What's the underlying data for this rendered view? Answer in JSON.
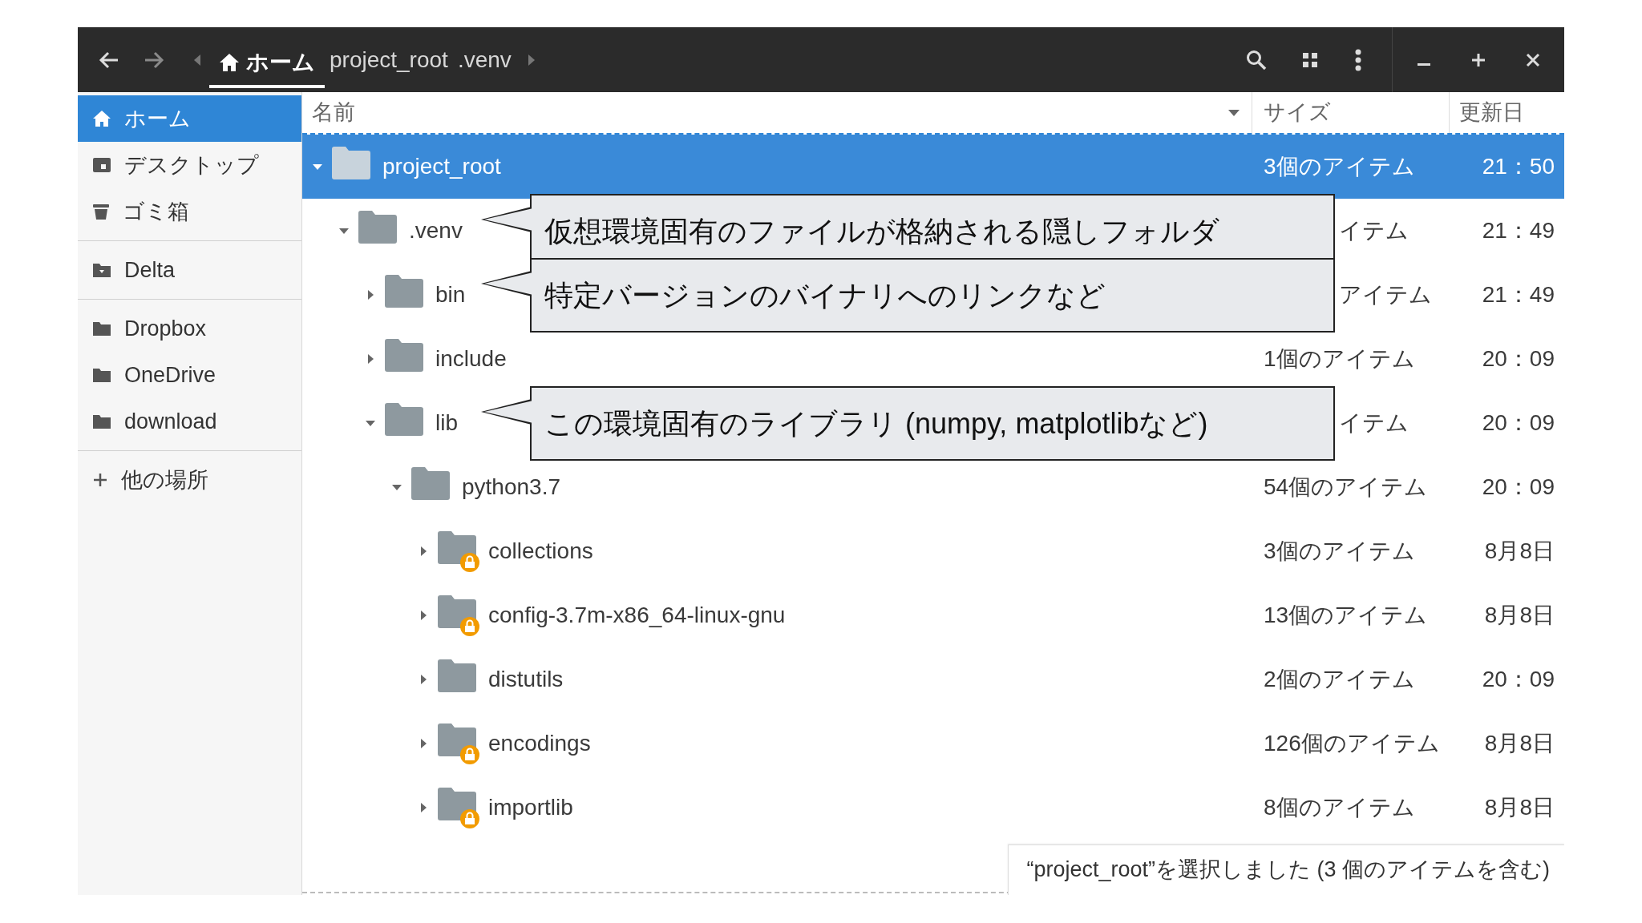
{
  "header_bar": {
    "path": [
      {
        "label": "ホーム",
        "kind": "home",
        "selected": true
      },
      {
        "label": "project_root",
        "kind": "folder",
        "selected": false
      },
      {
        "label": ".venv",
        "kind": "folder",
        "selected": false
      }
    ]
  },
  "sidebar": {
    "sections": [
      [
        {
          "label": "ホーム",
          "kind": "home",
          "selected": true
        },
        {
          "label": "デスクトップ",
          "kind": "desktop",
          "selected": false
        },
        {
          "label": "ゴミ箱",
          "kind": "trash",
          "selected": false
        }
      ],
      [
        {
          "label": "Delta",
          "kind": "drive",
          "selected": false
        }
      ],
      [
        {
          "label": "Dropbox",
          "kind": "folder",
          "selected": false
        },
        {
          "label": "OneDrive",
          "kind": "folder",
          "selected": false
        },
        {
          "label": "download",
          "kind": "folder",
          "selected": false
        }
      ],
      [
        {
          "label": "他の場所",
          "kind": "add",
          "selected": false
        }
      ]
    ]
  },
  "table": {
    "columns": [
      {
        "label": "名前",
        "sorted": true
      },
      {
        "label": "サイズ",
        "sorted": false
      },
      {
        "label": "更新日",
        "sorted": false
      }
    ],
    "rows": [
      {
        "name": "project_root",
        "size": "3個のアイテム",
        "modified": "21：50",
        "expanded": true,
        "selected": true,
        "locked": false,
        "children": [
          {
            "name": ".venv",
            "size": "イテム",
            "modified": "21：49",
            "expanded": true,
            "selected": false,
            "locked": false,
            "callout": "仮想環境固有のファイルが格納される隠しフォルダ",
            "children": [
              {
                "name": "bin",
                "size": "アイテム",
                "modified": "21：49",
                "expanded": false,
                "selected": false,
                "locked": false,
                "callout": "特定バージョンのバイナリへのリンクなど"
              },
              {
                "name": "include",
                "size": "1個のアイテム",
                "modified": "20：09",
                "expanded": false,
                "selected": false,
                "locked": false
              },
              {
                "name": "lib",
                "size": "イテム",
                "modified": "20：09",
                "expanded": true,
                "selected": false,
                "locked": false,
                "callout": "この環境固有のライブラリ (numpy, matplotlibなど)",
                "children": [
                  {
                    "name": "python3.7",
                    "size": "54個のアイテム",
                    "modified": "20：09",
                    "expanded": true,
                    "selected": false,
                    "locked": false,
                    "children": [
                      {
                        "name": "collections",
                        "size": "3個のアイテム",
                        "modified": "8月8日",
                        "expanded": false,
                        "selected": false,
                        "locked": true
                      },
                      {
                        "name": "config-3.7m-x86_64-linux-gnu",
                        "size": "13個のアイテム",
                        "modified": "8月8日",
                        "expanded": false,
                        "selected": false,
                        "locked": true
                      },
                      {
                        "name": "distutils",
                        "size": "2個のアイテム",
                        "modified": "20：09",
                        "expanded": false,
                        "selected": false,
                        "locked": false
                      },
                      {
                        "name": "encodings",
                        "size": "126個のアイテム",
                        "modified": "8月8日",
                        "expanded": false,
                        "selected": false,
                        "locked": true
                      },
                      {
                        "name": "importlib",
                        "size": "8個のアイテム",
                        "modified": "8月8日",
                        "expanded": false,
                        "selected": false,
                        "locked": true
                      }
                    ]
                  }
                ]
              }
            ]
          }
        ]
      }
    ]
  },
  "status": "“project_root”を選択しました (3 個のアイテムを含む)"
}
